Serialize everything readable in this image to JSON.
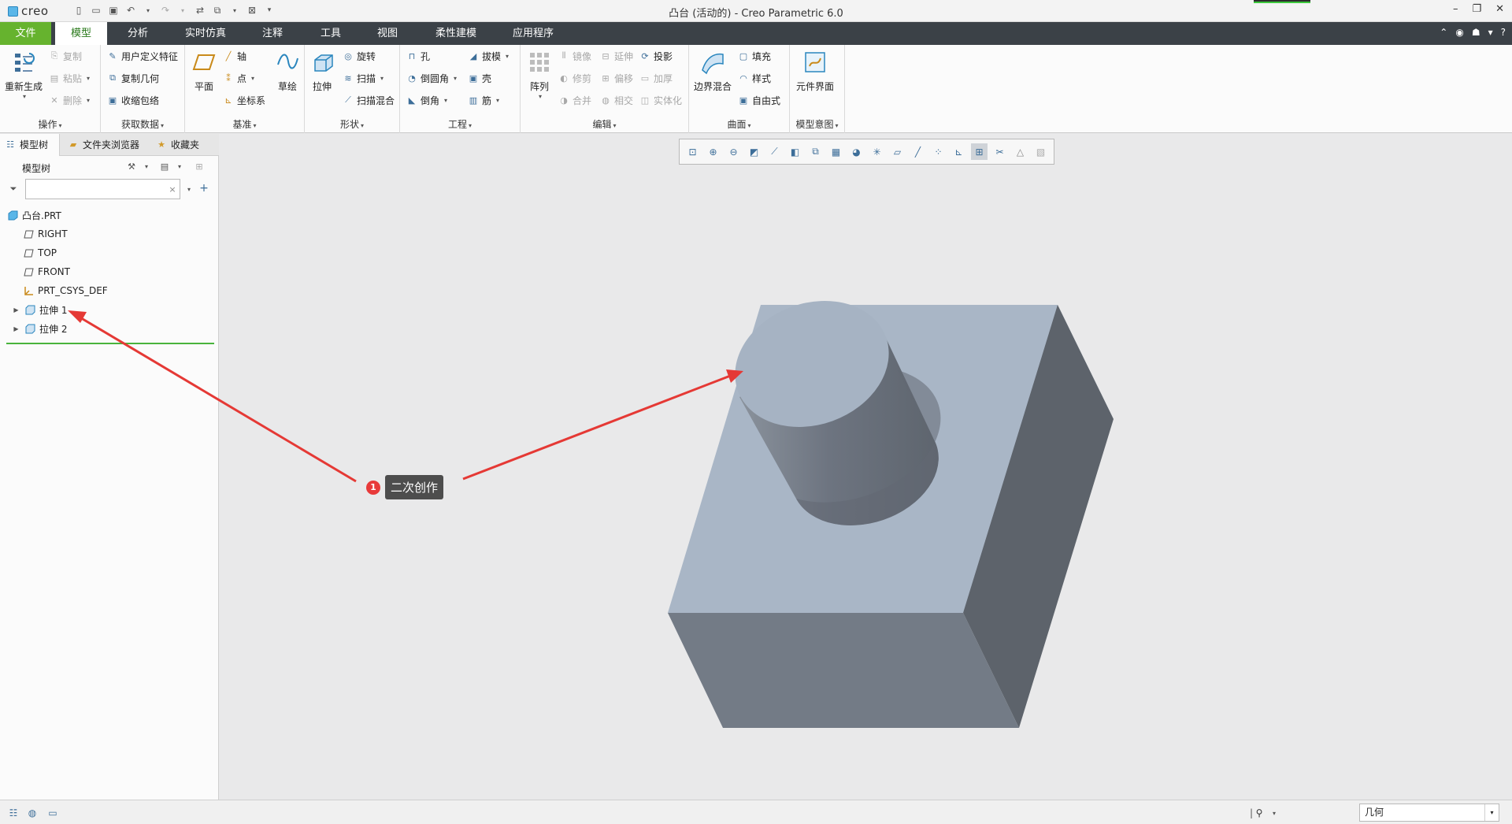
{
  "app": {
    "logo_text": "creo",
    "window_title": "凸台 (活动的) - Creo Parametric 6.0",
    "window_controls": [
      "–",
      "❐",
      "✕"
    ]
  },
  "tabs": [
    {
      "label": "文件"
    },
    {
      "label": "模型"
    },
    {
      "label": "分析"
    },
    {
      "label": "实时仿真"
    },
    {
      "label": "注释"
    },
    {
      "label": "工具"
    },
    {
      "label": "视图"
    },
    {
      "label": "柔性建模"
    },
    {
      "label": "应用程序"
    }
  ],
  "ribbon": {
    "operations": {
      "title": "操作",
      "regenerate": "重新生成",
      "copy": "复制",
      "paste": "粘贴",
      "delete": "删除"
    },
    "get_data": {
      "title": "获取数据",
      "udf": "用户定义特征",
      "copy_geom": "复制几何",
      "shrinkwrap": "收缩包络"
    },
    "datum": {
      "title": "基准",
      "plane": "平面",
      "axis": "轴",
      "point": "点",
      "csys": "坐标系",
      "sketch": "草绘"
    },
    "shapes": {
      "title": "形状",
      "extrude": "拉伸",
      "revolve": "旋转",
      "sweep": "扫描",
      "swept_blend": "扫描混合"
    },
    "engineering": {
      "title": "工程",
      "hole": "孔",
      "round": "倒圆角",
      "chamfer": "倒角",
      "draft": "拔模",
      "shell": "壳",
      "rib": "筋"
    },
    "editing": {
      "title": "编辑",
      "pattern": "阵列",
      "mirror": "镜像",
      "trim": "修剪",
      "merge": "合并",
      "extend": "延伸",
      "offset": "偏移",
      "intersect": "相交",
      "project": "投影",
      "thicken": "加厚",
      "solidify": "实体化"
    },
    "surfaces": {
      "title": "曲面",
      "boundary_blend": "边界混合",
      "fill": "填充",
      "style": "样式",
      "freestyle": "自由式"
    },
    "model_intent": {
      "title": "模型意图",
      "component_interface": "元件界面"
    }
  },
  "panel": {
    "tabs": [
      {
        "label": "模型树"
      },
      {
        "label": "文件夹浏览器"
      },
      {
        "label": "收藏夹"
      }
    ],
    "tree_header": "模型树",
    "search_value": "",
    "tree": [
      {
        "label": "凸台.PRT",
        "icon": "part-icon"
      },
      {
        "label": "RIGHT",
        "icon": "datum-plane-icon"
      },
      {
        "label": "TOP",
        "icon": "datum-plane-icon"
      },
      {
        "label": "FRONT",
        "icon": "datum-plane-icon"
      },
      {
        "label": "PRT_CSYS_DEF",
        "icon": "csys-icon"
      },
      {
        "label": "拉伸 1",
        "icon": "extrude-feature-icon"
      },
      {
        "label": "拉伸 2",
        "icon": "extrude-feature-icon"
      }
    ]
  },
  "callout": {
    "number": "1",
    "text": "二次创作",
    "color": "#e83a3a"
  },
  "status": {
    "selection_filter": "几何"
  },
  "colors": {
    "tab_bar": "#3b4147",
    "file_tab": "#66b32e",
    "model_face_top": "#a9b6c6",
    "model_face_front": "#737b86",
    "model_face_side": "#5d636b"
  }
}
